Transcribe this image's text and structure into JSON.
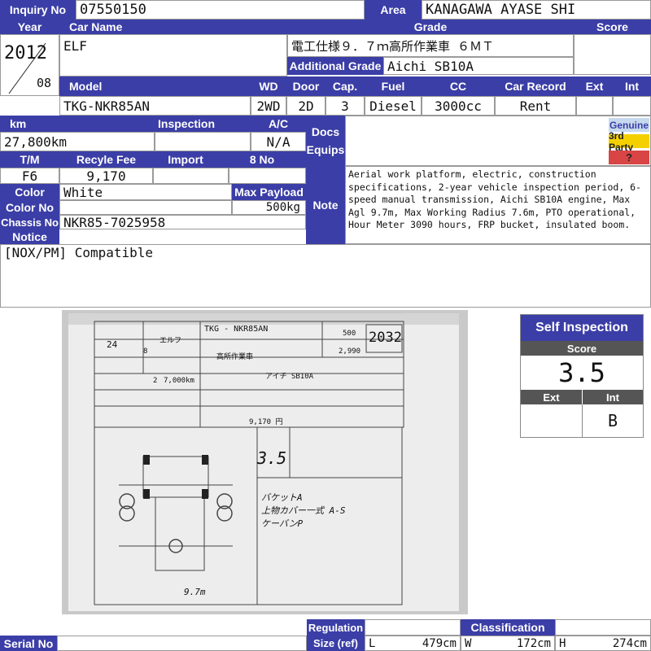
{
  "header": {
    "inquiry_label": "Inquiry No",
    "inquiry_no": "07550150",
    "area_label": "Area",
    "area": "KANAGAWA AYASE SHI"
  },
  "row1": {
    "year_label": "Year",
    "year": "2012",
    "month": "08",
    "car_name_label": "Car Name",
    "car_name": "ELF",
    "grade_label": "Grade",
    "grade": "電工仕様９．７ｍ高所作業車 ６ＭＴ",
    "additional_grade_label": "Additional Grade",
    "additional_grade": "Aichi SB10A",
    "score_label": "Score",
    "score": ""
  },
  "row2": {
    "model_label": "Model",
    "model": "TKG-NKR85AN",
    "wd_label": "WD",
    "wd": "2WD",
    "door_label": "Door",
    "door": "2D",
    "cap_label": "Cap.",
    "cap": "3",
    "fuel_label": "Fuel",
    "fuel": "Diesel",
    "cc_label": "CC",
    "cc": "3000cc",
    "car_record_label": "Car Record",
    "car_record": "Rent",
    "ext_label": "Ext",
    "ext": "",
    "int_label": "Int",
    "int": ""
  },
  "row3": {
    "km_label": "km",
    "km": "27,800km",
    "inspection_label": "Inspection",
    "inspection": "",
    "ac_label": "A/C",
    "ac": "N/A",
    "docs_label": "Docs Equips",
    "genuine_label": "Genuine",
    "third_party_label": "3rd Party",
    "question_label": "?"
  },
  "row4": {
    "tm_label": "T/M",
    "tm": "F6",
    "recycle_label": "Recyle Fee",
    "recycle": "9,170",
    "import_label": "Import",
    "import": "",
    "eight_no_label": "8 No",
    "eight_no": "",
    "color_label": "Color",
    "color": "White",
    "color_no_label": "Color No",
    "color_no": "",
    "max_payload_label": "Max Payload",
    "max_payload": "500kg",
    "chassis_label": "Chassis No",
    "chassis": "NKR85-7025958",
    "note_label": "Note",
    "note": "Aerial work platform, electric, construction specifications, 2-year vehicle inspection period, 6-speed manual transmission, Aichi SB10A engine, Max Agl 9.7m, Max Working Radius 7.6m, PTO operational, Hour Meter 3090 hours, FRP bucket, insulated boom."
  },
  "notice": {
    "label": "Notice",
    "text": "[NOX/PM] Compatible"
  },
  "self_inspection": {
    "title": "Self Inspection",
    "score_label": "Score",
    "score": "3.5",
    "ext_label": "Ext",
    "int_label": "Int",
    "ext": "",
    "int": "B"
  },
  "sheet": {
    "model_code": "TKG -  NKR85AN",
    "name": "エルフ",
    "type": "高所作業車",
    "year": "24",
    "month": "8",
    "km": "7,000km",
    "cap": "2",
    "weight_1": "500",
    "weight_2": "2,990",
    "lot": "2032",
    "engine": "アイチ SB10A",
    "recycle": "9,170 円",
    "score_hand": "3.5",
    "hand_1": "バケットA",
    "hand_2": "上物カバー一式 A-S",
    "hand_3": "ケーバンP",
    "bottom_hand": "9.7m"
  },
  "footer": {
    "serial_label": "Serial No",
    "serial": "",
    "regulation_label": "Regulation",
    "size_label": "Size (ref)",
    "classification_label": "Classification",
    "classification": "",
    "l_label": "L",
    "l": "479cm",
    "w_label": "W",
    "w": "172cm",
    "h_label": "H",
    "h": "274cm"
  },
  "colors": {
    "header_bg": "#3b3ea6",
    "genuine_bg": "#c6d9ee",
    "third_party_bg": "#f5d000",
    "question_bg": "#d94545"
  }
}
